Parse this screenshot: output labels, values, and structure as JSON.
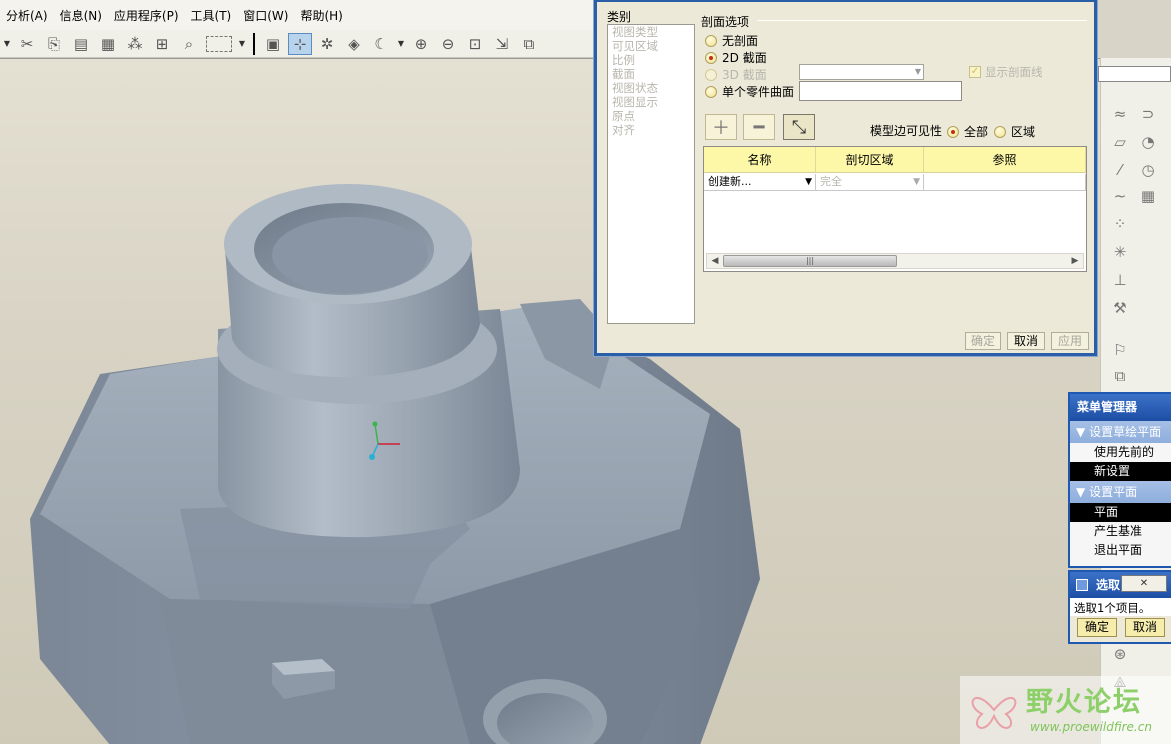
{
  "menubar": {
    "items": [
      "分析(A)",
      "信息(N)",
      "应用程序(P)",
      "工具(T)",
      "窗口(W)",
      "帮助(H)"
    ]
  },
  "toolbar": {
    "icons": [
      "drop-arrow-icon",
      "cut-icon",
      "copy-icon",
      "paste-icon",
      "paste-special-icon",
      "regenerate-icon",
      "regenerate-manager-icon",
      "find-icon",
      "select-box-icon",
      "model-tree-icon",
      "datum-display-icon",
      "spin-center-icon",
      "view-manager-icon",
      "shading-icon",
      "zoom-in-icon",
      "zoom-out-icon",
      "refit-icon",
      "reorient-icon",
      "saved-views-icon"
    ],
    "active_icon": "datum-display-icon"
  },
  "view_dialog": {
    "category": {
      "title": "类别",
      "items": [
        "视图类型",
        "可见区域",
        "比例",
        "截面",
        "视图状态",
        "视图显示",
        "原点",
        "对齐"
      ]
    },
    "section_options": {
      "title": "剖面选项",
      "no_section": "无剖面",
      "section_2d": "2D 截面",
      "section_3d": "3D 截面",
      "single_part_surface": "单个零件曲面",
      "selected": "2D 截面",
      "show_hatch": "显示剖面线"
    },
    "edge_visibility": {
      "label": "模型边可见性",
      "all": "全部",
      "area": "区域",
      "selected": "全部"
    },
    "table": {
      "headers": [
        "名称",
        "剖切区域",
        "参照"
      ],
      "row": {
        "name": "创建新...",
        "area": "完全",
        "reference": ""
      }
    },
    "buttons": {
      "ok": "确定",
      "cancel": "取消",
      "apply": "应用"
    }
  },
  "menu_manager": {
    "title": "菜单管理器",
    "sections": [
      {
        "title": "设置草绘平面",
        "items": [
          "使用先前的",
          "新设置"
        ],
        "selected": "新设置"
      },
      {
        "title": "设置平面",
        "items": [
          "平面",
          "产生基准",
          "退出平面"
        ],
        "selected": "平面"
      }
    ]
  },
  "select_dialog": {
    "title": "选取",
    "message": "选取1个项目。",
    "ok": "确定",
    "cancel": "取消"
  },
  "watermark": {
    "title": "野火论坛",
    "url": "www.proewildfire.cn"
  },
  "colors": {
    "dialog_border": "#2a5fa8",
    "menu_title": "#1c4ea4",
    "model_gray": "#8a96a4",
    "table_header": "#fdf7a8"
  }
}
